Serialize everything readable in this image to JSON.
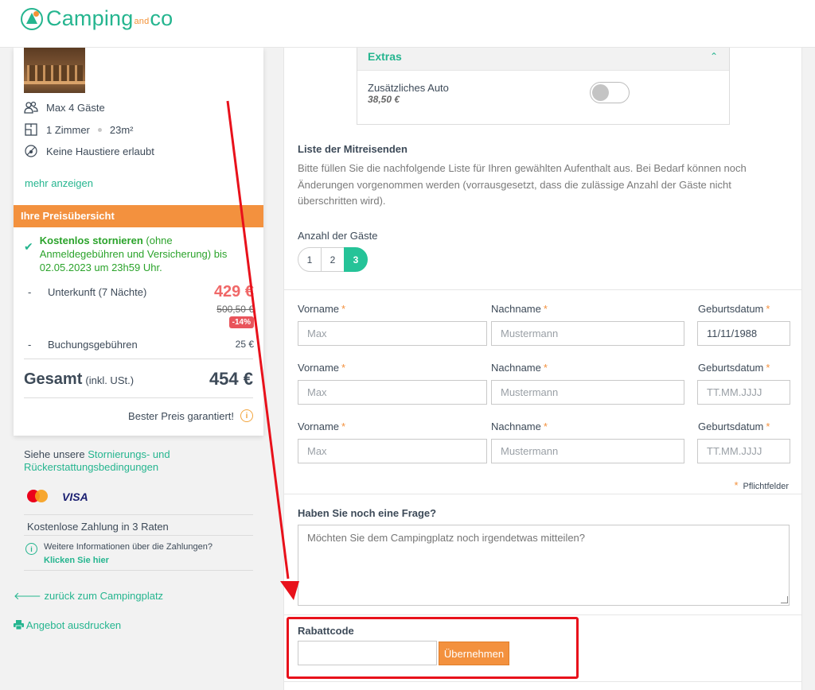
{
  "brand": {
    "name_part1": "Camping",
    "name_and": "and",
    "name_part2": "co",
    "color": "#25b58f",
    "accent": "#f39237"
  },
  "property": {
    "features": [
      {
        "icon": "people-icon",
        "text": "Max 4 Gäste"
      },
      {
        "icon": "floorplan-icon",
        "rooms": "1 Zimmer",
        "area": "23m²"
      },
      {
        "icon": "no-pets-icon",
        "text": "Keine Haustiere erlaubt"
      }
    ],
    "more_link": "mehr anzeigen"
  },
  "price_overview": {
    "header": "Ihre Preisübersicht",
    "cancel_bold": "Kostenlos stornieren",
    "cancel_text": "(ohne Anmeldegebühren und Versicherung) bis 02.05.2023 um 23h59 Uhr.",
    "items": [
      {
        "dash": "-",
        "label": "Unterkunft (7 Nächte)",
        "price": "429 €",
        "old_price": "500,50 €",
        "badge": "-14%"
      },
      {
        "dash": "-",
        "label": "Buchungsgebühren",
        "price": "25 €"
      }
    ],
    "total_label": "Gesamt",
    "total_sub": "(inkl. USt.)",
    "total_value": "454 €",
    "best_price": "Bester Preis garantiert!",
    "info_glyph": "i"
  },
  "sidebar_links": {
    "cond_prefix": "Siehe unsere ",
    "cond_link": "Stornierungs- und Rückerstattungsbedingungen",
    "visa": "VISA",
    "free_payment": "Kostenlose Zahlung in 3 Raten",
    "more_info_text": "Weitere Informationen über die Zahlungen?",
    "more_info_link": "Klicken Sie hier",
    "info_glyph": "i",
    "back": "zurück zum Campingplatz",
    "print": "Angebot ausdrucken"
  },
  "extras": {
    "title": "Extras",
    "item_name": "Zusätzliches Auto",
    "item_price": "38,50 €",
    "toggle_on": false
  },
  "travelers": {
    "title": "Liste der Mitreisenden",
    "description": "Bitte füllen Sie die nachfolgende Liste für Ihren gewählten Aufenthalt aus. Bei Bedarf können noch Änderungen vorgenommen werden (vorrausgesetzt, dass die zulässige Anzahl der Gäste nicht überschritten wird).",
    "guests_label": "Anzahl der Gäste",
    "guest_options": [
      "1",
      "2",
      "3"
    ],
    "selected_guests": "3",
    "labels": {
      "firstname": "Vorname",
      "lastname": "Nachname",
      "birthdate": "Geburtsdatum",
      "required_mark": "*"
    },
    "rows": [
      {
        "firstname_placeholder": "Max",
        "lastname_placeholder": "Mustermann",
        "birthdate_value": "11/11/1988"
      },
      {
        "firstname_placeholder": "Max",
        "lastname_placeholder": "Mustermann",
        "birthdate_placeholder": "TT.MM.JJJJ"
      },
      {
        "firstname_placeholder": "Max",
        "lastname_placeholder": "Mustermann",
        "birthdate_placeholder": "TT.MM.JJJJ"
      }
    ],
    "required_note": "Pflichtfelder"
  },
  "question": {
    "title": "Haben Sie noch eine Frage?",
    "placeholder": "Möchten Sie dem Campingplatz noch irgendetwas mitteilen?"
  },
  "coupon": {
    "title": "Rabattcode",
    "button": "Übernehmen"
  },
  "annotation": {
    "color": "#e8111b"
  }
}
